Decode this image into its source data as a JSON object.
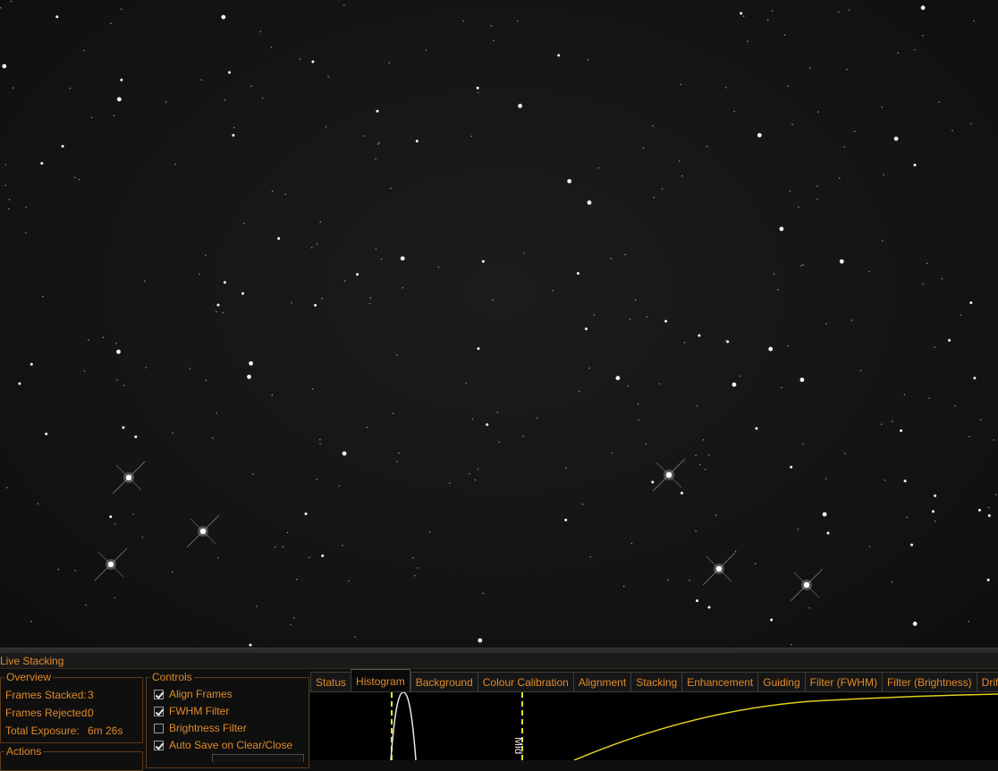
{
  "viewer": {
    "description_icon": "star-field-image"
  },
  "panel": {
    "title": "Live Stacking"
  },
  "overview": {
    "legend": "Overview",
    "rows": [
      {
        "label": "Frames Stacked:",
        "value": "3"
      },
      {
        "label": "Frames Rejected:",
        "value": "0"
      },
      {
        "label": "Total Exposure:",
        "value": "6m 26s"
      }
    ]
  },
  "actions": {
    "legend": "Actions"
  },
  "controls": {
    "legend": "Controls",
    "items": [
      {
        "label": "Align Frames",
        "checked": true
      },
      {
        "label": "FWHM Filter",
        "checked": true
      },
      {
        "label": "Brightness Filter",
        "checked": false
      },
      {
        "label": "Auto Save on Clear/Close",
        "checked": true
      }
    ]
  },
  "tabs": [
    {
      "label": "Status",
      "active": false
    },
    {
      "label": "Histogram",
      "active": true
    },
    {
      "label": "Background",
      "active": false
    },
    {
      "label": "Colour Calibration",
      "active": false
    },
    {
      "label": "Alignment",
      "active": false
    },
    {
      "label": "Stacking",
      "active": false
    },
    {
      "label": "Enhancement",
      "active": false
    },
    {
      "label": "Guiding",
      "active": false
    },
    {
      "label": "Filter (FWHM)",
      "active": false
    },
    {
      "label": "Filter (Brightness)",
      "active": false
    },
    {
      "label": "Drif",
      "active": false
    }
  ],
  "histogram": {
    "mid_label": "Mid"
  },
  "colors": {
    "accent": "#e08a2a",
    "curve": "#e0d020",
    "marker": "#e8e020"
  }
}
